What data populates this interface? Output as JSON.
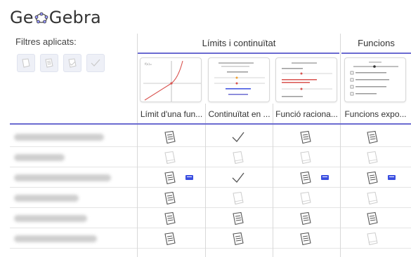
{
  "app": {
    "logo_text_left": "Ge",
    "logo_text_right": "Gebra",
    "logo_icon": "geogebra-ring-icon"
  },
  "filters": {
    "label": "Filtres aplicats:",
    "icons": [
      "empty-book-icon",
      "hand-in-icon",
      "hand-in-check-icon",
      "check-icon"
    ]
  },
  "groups": [
    {
      "label": "Límits i continuïtat"
    },
    {
      "label": "Funcions"
    }
  ],
  "columns": [
    {
      "label": "Límit d'una fun...",
      "thumb": "graph"
    },
    {
      "label": "Continuïtat en ...",
      "thumb": "text1"
    },
    {
      "label": "Funció raciona...",
      "thumb": "text2"
    },
    {
      "label": "Funcions expo...",
      "thumb": "checklist"
    }
  ],
  "rows": [
    {
      "cells": [
        "submitted",
        "check",
        "submitted",
        "submitted"
      ],
      "msgs": [
        false,
        false,
        false,
        false
      ]
    },
    {
      "cells": [
        "empty",
        "empty",
        "empty",
        "empty"
      ],
      "msgs": [
        false,
        false,
        false,
        false
      ]
    },
    {
      "cells": [
        "submitted",
        "check",
        "submitted",
        "submitted"
      ],
      "msgs": [
        true,
        false,
        true,
        true
      ]
    },
    {
      "cells": [
        "submitted",
        "empty",
        "empty",
        "empty"
      ],
      "msgs": [
        false,
        false,
        false,
        false
      ]
    },
    {
      "cells": [
        "submitted",
        "submitted",
        "submitted",
        "submitted"
      ],
      "msgs": [
        false,
        false,
        false,
        false
      ]
    },
    {
      "cells": [
        "submitted",
        "submitted",
        "submitted",
        "empty"
      ],
      "msgs": [
        false,
        false,
        false,
        false
      ]
    }
  ],
  "colors": {
    "accent": "#6b6bd1",
    "message": "#3a4ee0",
    "icon": "#555555",
    "icon_faded": "#cccccc"
  }
}
